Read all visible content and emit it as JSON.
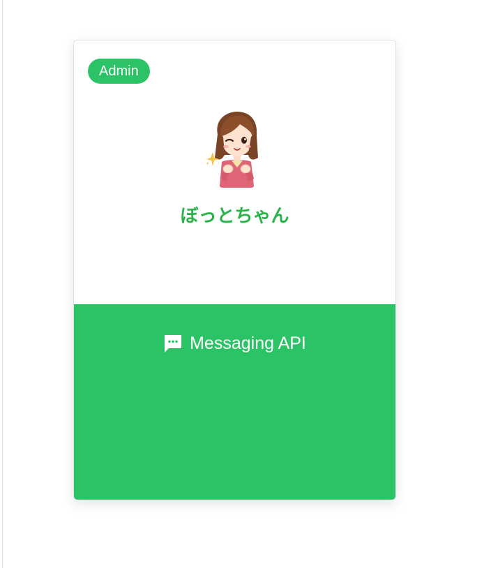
{
  "bot_card": {
    "role_badge": "Admin",
    "avatar_icon": "cartoon-girl-winking-avatar",
    "bot_name": "ぼっとちゃん",
    "channel_icon": "chat-bubble-icon",
    "channel_type": "Messaging API",
    "accent_color": "#2bc365",
    "name_color": "#2bb34a"
  }
}
